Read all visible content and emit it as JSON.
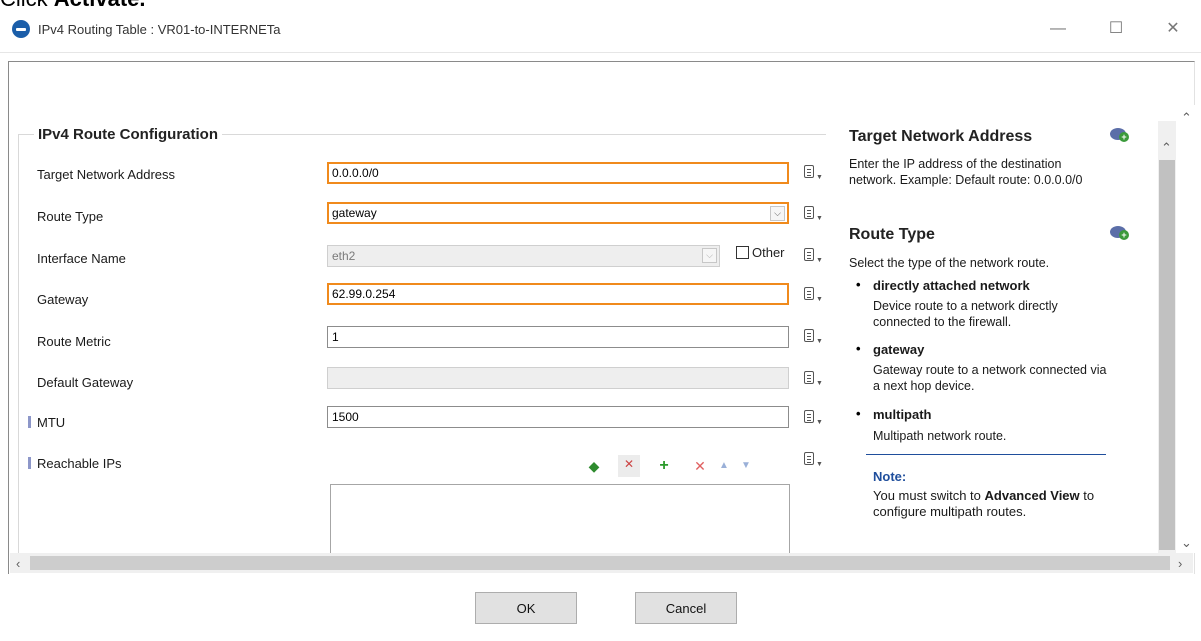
{
  "caption": {
    "prefix": "Click ",
    "bold": "Activate."
  },
  "window": {
    "title": "IPv4 Routing Table : VR01-to-INTERNETa",
    "minimize": "—",
    "maximize": "☐",
    "close": "✕"
  },
  "form": {
    "group_title": "IPv4 Route Configuration",
    "fields": {
      "target_label": "Target Network Address",
      "target_value": "0.0.0.0/0",
      "route_type_label": "Route Type",
      "route_type_value": "gateway",
      "interface_label": "Interface Name",
      "interface_value": "eth2",
      "other_label": "Other",
      "gateway_label": "Gateway",
      "gateway_value": "62.99.0.254",
      "metric_label": "Route Metric",
      "metric_value": "1",
      "default_gw_label": "Default Gateway",
      "default_gw_value": "",
      "mtu_label": "MTU",
      "mtu_value": "1500",
      "reachable_label": "Reachable IPs"
    }
  },
  "help": {
    "h1": "Target Network Address",
    "p1": "Enter the IP address of the destination network. Example: Default route: 0.0.0.0/0",
    "h2": "Route Type",
    "p2": "Select the type of the network route.",
    "items": [
      {
        "title": "directly attached network",
        "desc": "Device route to a network directly connected to the firewall."
      },
      {
        "title": "gateway",
        "desc": "Gateway route to a network connected via a next hop device."
      },
      {
        "title": "multipath",
        "desc": "Multipath network route."
      }
    ],
    "note_title": "Note:",
    "note_pre": "You must switch to ",
    "note_bold": "Advanced View",
    "note_post": " to configure multipath routes."
  },
  "buttons": {
    "ok": "OK",
    "cancel": "Cancel"
  },
  "colors": {
    "highlight": "#f08a1c",
    "note_rule": "#1f4e9c"
  },
  "icons": [
    "app-icon",
    "config-menu-icon",
    "import-icon",
    "clear-icon",
    "add-icon",
    "delete-icon",
    "move-up-icon",
    "move-down-icon",
    "help-bubble-icon"
  ]
}
